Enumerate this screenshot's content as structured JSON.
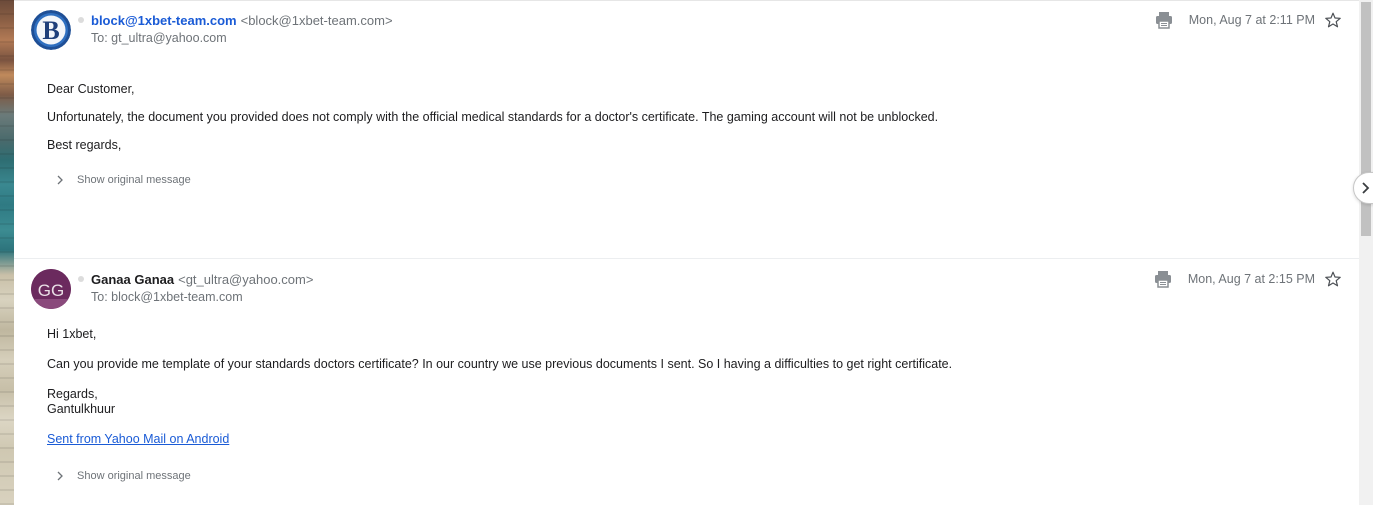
{
  "messages": [
    {
      "avatar_letters": "B",
      "sender_name": "block@1xbet-team.com",
      "sender_email": "<block@1xbet-team.com>",
      "to": "To: gt_ultra@yahoo.com",
      "date": "Mon, Aug 7 at 2:11 PM",
      "body": {
        "greeting": "Dear Customer,",
        "line1": "Unfortunately, the document you provided does not comply with the official medical standards for a doctor's certificate. The gaming account will not be unblocked.",
        "closing": "Best regards,"
      },
      "show_original": "Show original message"
    },
    {
      "avatar_letters": "GG",
      "sender_name": "Ganaa Ganaa",
      "sender_email": "<gt_ultra@yahoo.com>",
      "to": "To: block@1xbet-team.com",
      "date": "Mon, Aug 7 at 2:15 PM",
      "body": {
        "greeting": "Hi 1xbet,",
        "line1": "Can you provide me template of your standards doctors certificate? In our country we use previous documents I sent. So I having a difficulties to get right certificate.",
        "closing": "Regards,",
        "signature": "Gantulkhuur",
        "link": "Sent from Yahoo Mail on Android"
      },
      "show_original": "Show original message"
    }
  ],
  "icons": {
    "print": "printer-icon",
    "star": "star-outline-icon",
    "chevron": "chevron-right-icon",
    "next": "next-arrow-icon"
  },
  "colors": {
    "link_blue": "#1a5bd6",
    "muted_gray": "#6e7378",
    "avatar_gg_bg": "#6b2a5e"
  }
}
